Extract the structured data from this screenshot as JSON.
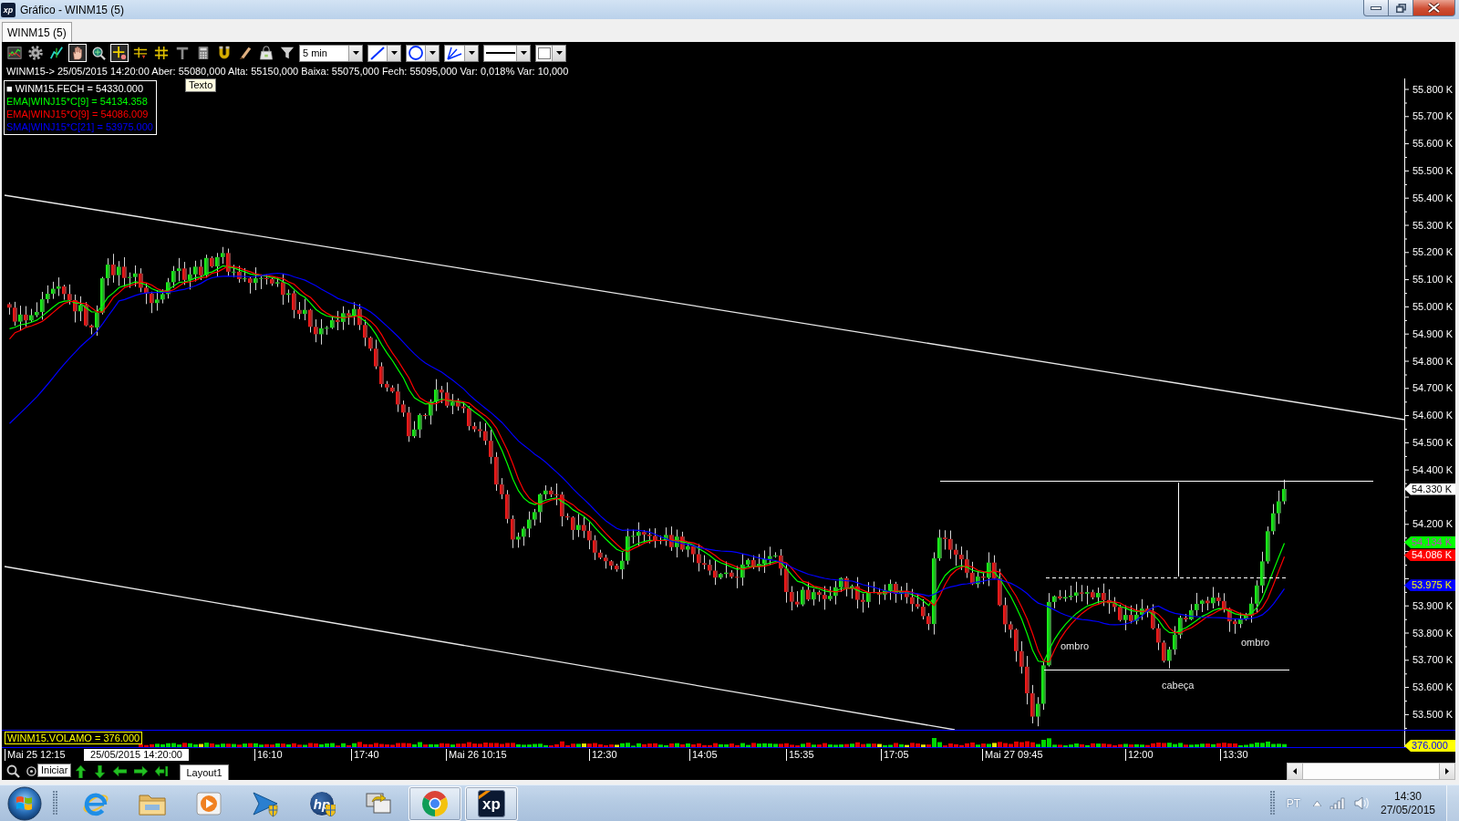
{
  "window": {
    "logo": "xp",
    "title": "Gráfico - WINM15 (5)"
  },
  "tabs": [
    {
      "label": "WINM15 (5)",
      "selected": true
    }
  ],
  "toolbar": {
    "tools": [
      {
        "selected": false
      },
      {
        "selected": false
      },
      {
        "selected": false
      },
      {
        "selected": true
      },
      {
        "selected": false
      },
      {
        "selected": true
      },
      {
        "selected": false
      },
      {
        "selected": false
      },
      {
        "selected": false
      },
      {
        "selected": false
      },
      {
        "selected": false
      },
      {
        "selected": false
      },
      {
        "selected": false
      },
      {
        "selected": false
      }
    ],
    "interval": "5 min"
  },
  "quote_line": "WINM15-> 25/05/2015 14:20:00 Aber: 55080,000 Alta: 55150,000 Baixa: 55075,000 Fech: 55095,000 Var: 0,018% Var: 10,000",
  "tooltip": "Texto",
  "legend": [
    {
      "text": "■ WINM15.FECH = 54330.000",
      "color": "#ffffff"
    },
    {
      "text": "EMA|WINJ15*C[9] = 54134.358",
      "color": "#00ff00"
    },
    {
      "text": "EMA|WINJ15*O[9] = 54086.009",
      "color": "#ff0000"
    },
    {
      "text": "SMA|WINJ15*C[21] = 53975.000",
      "color": "#0000ff"
    }
  ],
  "annotations": [
    "ombro",
    "cabeça",
    "ombro"
  ],
  "price_axis": {
    "ticks": [
      "55.800 K",
      "55.700 K",
      "55.600 K",
      "55.500 K",
      "55.400 K",
      "55.300 K",
      "55.200 K",
      "55.100 K",
      "55.000 K",
      "54.900 K",
      "54.800 K",
      "54.700 K",
      "54.600 K",
      "54.500 K",
      "54.400 K",
      "54.200 K",
      "53.900 K",
      "53.800 K",
      "53.700 K",
      "53.600 K",
      "53.500 K"
    ],
    "markers": [
      {
        "label": "54.330 K",
        "color": "#ffffff"
      },
      {
        "label": "54.134 K",
        "color": "#00ff00"
      },
      {
        "label": "54.086 K",
        "color": "#ff0000"
      },
      {
        "label": "53.975 K",
        "color": "#0000ff"
      }
    ]
  },
  "volume": {
    "label": "WINM15.VOLAMO = 376.000",
    "marker": "376.000"
  },
  "time_axis": {
    "labels": [
      "Mai 25 12:15",
      "16:10",
      "17:40",
      "Mai 26 10:15",
      "12:30",
      "14:05",
      "15:35",
      "17:05",
      "Mai 27 09:45",
      "12:00",
      "13:30"
    ],
    "cursor": "25/05/2015 14:20:00"
  },
  "bottom_bar": {
    "tooltip": "Iniciar",
    "layouts": [
      {
        "label": "Layout1",
        "selected": true
      }
    ]
  },
  "taskbar": {
    "apps": [
      {
        "running": false
      },
      {
        "running": false
      },
      {
        "running": false
      },
      {
        "running": false
      },
      {
        "running": false,
        "logo": "hp"
      },
      {
        "running": false
      },
      {
        "running": true
      },
      {
        "running": true,
        "logo": "xp"
      }
    ],
    "tray": {
      "language": "PT",
      "time": "14:30",
      "date": "27/05/2015"
    }
  }
}
